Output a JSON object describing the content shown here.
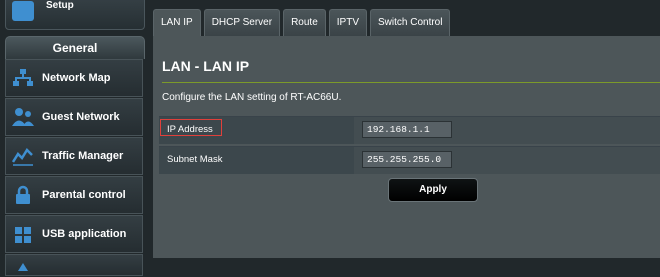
{
  "sidebar": {
    "quick_setup_label": "Quick Internet Setup",
    "section_title": "General",
    "items": [
      {
        "label": "Network Map",
        "icon": "network-map-icon"
      },
      {
        "label": "Guest Network",
        "icon": "guest-network-icon"
      },
      {
        "label": "Traffic Manager",
        "icon": "traffic-manager-icon"
      },
      {
        "label": "Parental control",
        "icon": "parental-control-icon"
      },
      {
        "label": "USB application",
        "icon": "usb-application-icon"
      }
    ]
  },
  "tabs": [
    {
      "label": "LAN IP",
      "active": true
    },
    {
      "label": "DHCP Server"
    },
    {
      "label": "Route"
    },
    {
      "label": "IPTV"
    },
    {
      "label": "Switch Control"
    }
  ],
  "page": {
    "title": "LAN - LAN IP",
    "description": "Configure the LAN setting of RT-AC66U."
  },
  "fields": [
    {
      "label": "IP Address",
      "value": "192.168.1.1"
    },
    {
      "label": "Subnet Mask",
      "value": "255.255.255.0"
    }
  ],
  "apply_label": "Apply",
  "colors": {
    "accent": "#7c9a2a",
    "highlight": "#e0403b",
    "icon_blue": "#3f8fd0"
  }
}
